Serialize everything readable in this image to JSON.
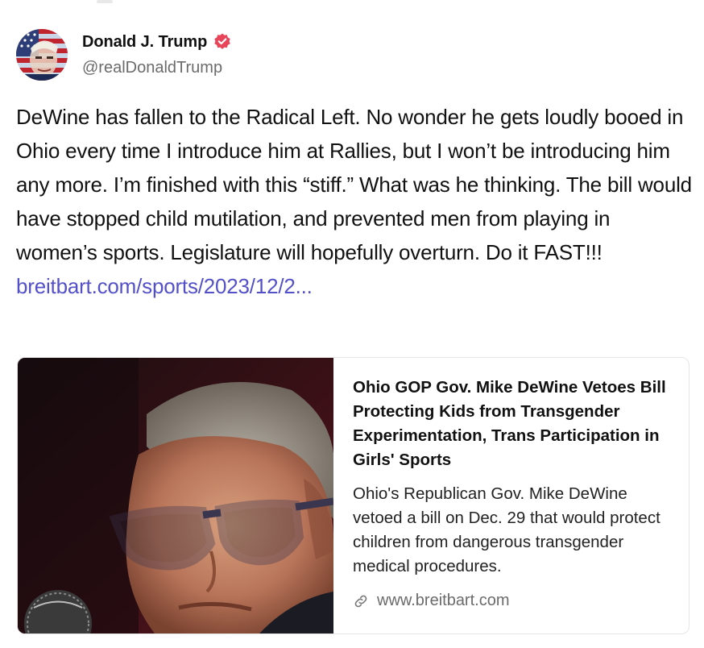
{
  "author": {
    "name": "Donald J. Trump",
    "handle": "@realDonaldTrump",
    "avatar_icon": "flag-portrait-avatar",
    "verified_icon": "verified-badge-icon",
    "verified_color": "#e8455a"
  },
  "post": {
    "text": "DeWine has fallen to the Radical Left. No wonder he gets loudly booed in Ohio every time I introduce him at Rallies, but I won’t be introducing him any more. I’m finished with this “stiff.” What was he thinking. The bill would have stopped child mutilation, and prevented men from playing in women’s sports. Legislature will hopefully overturn. Do it FAST!!!",
    "link_text": "breitbart.com/sports/2023/12/2...",
    "link_color": "#5350c9"
  },
  "link_card": {
    "title": "Ohio GOP Gov. Mike DeWine Vetoes Bill Protecting Kids from Transgender Experimentation, Trans Participation in Girls' Sports",
    "description": "Ohio's Republican Gov. Mike DeWine vetoed a bill on Dec. 29 that would protect children from dangerous transgender medical procedures.",
    "domain": "www.breitbart.com",
    "domain_icon": "link-icon",
    "image_icon": "article-photo"
  }
}
